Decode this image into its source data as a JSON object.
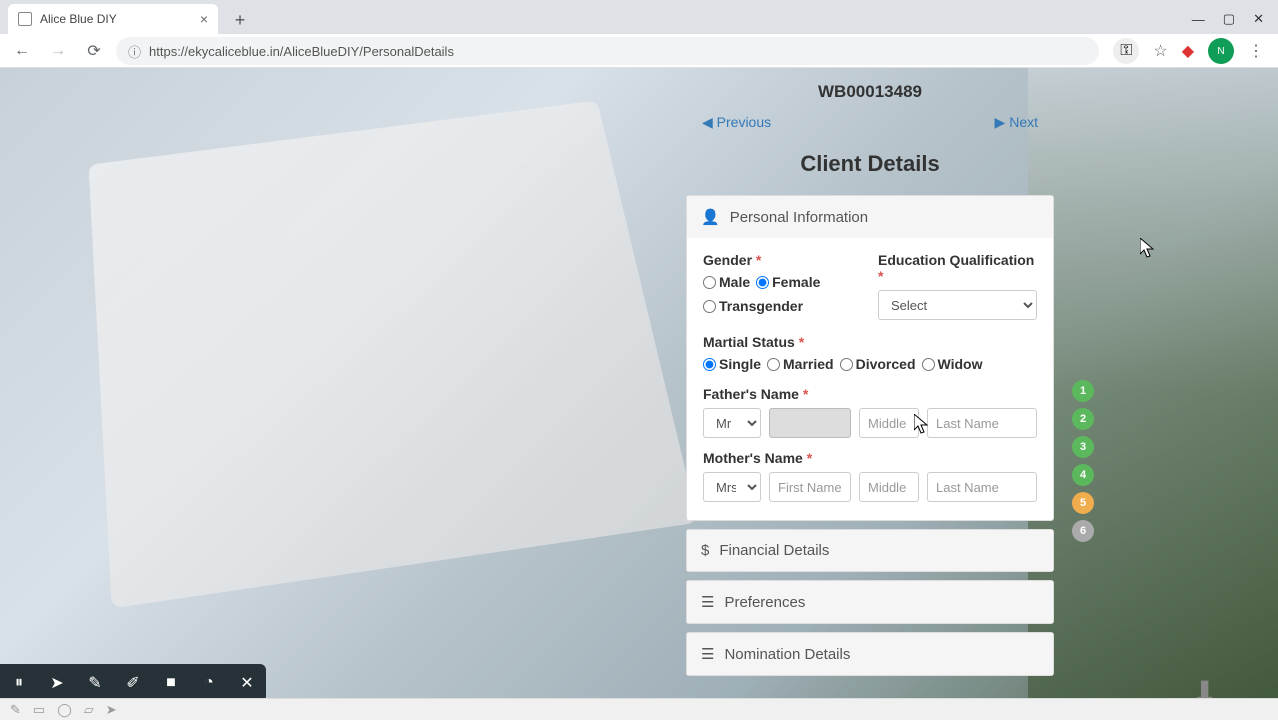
{
  "browser": {
    "tab_title": "Alice Blue DIY",
    "url": "https://ekycaliceblue.in/AliceBlueDIY/PersonalDetails"
  },
  "page": {
    "client_id": "WB00013489",
    "prev_label": "Previous",
    "next_label": "Next",
    "title": "Client Details"
  },
  "personal": {
    "header": "Personal Information",
    "gender": {
      "label": "Gender",
      "options": {
        "male": "Male",
        "female": "Female",
        "trans": "Transgender"
      },
      "selected": "female"
    },
    "education": {
      "label": "Education Qualification",
      "value": "Select"
    },
    "marital": {
      "label": "Martial Status",
      "options": {
        "single": "Single",
        "married": "Married",
        "divorced": "Divorced",
        "widow": "Widow"
      },
      "selected": "single"
    },
    "father": {
      "label": "Father's Name",
      "title": "Mr",
      "first": "",
      "middle_ph": "Middle",
      "last_ph": "Last Name"
    },
    "mother": {
      "label": "Mother's Name",
      "title": "Mrs",
      "first_ph": "First Name",
      "middle_ph": "Middle",
      "last_ph": "Last Name"
    }
  },
  "sections": {
    "financial": "Financial Details",
    "preferences": "Preferences",
    "nomination": "Nomination Details"
  },
  "steps": [
    "1",
    "2",
    "3",
    "4",
    "5",
    "6"
  ]
}
